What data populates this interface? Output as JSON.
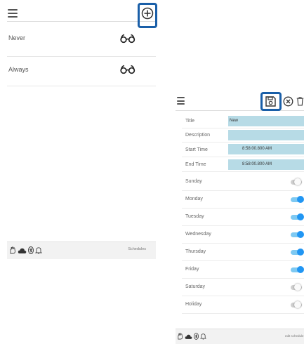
{
  "left_screen": {
    "add_icon": "plus-circle-icon",
    "schedules": [
      {
        "label": "Never",
        "icon": "glasses-icon"
      },
      {
        "label": "Always",
        "icon": "glasses-icon"
      }
    ],
    "status_icons": [
      "hand-icon",
      "cloud-icon",
      "bluetooth-icon",
      "bell-icon"
    ],
    "status_label": "Schedules"
  },
  "right_screen": {
    "toolbar_icons": [
      "save-icon",
      "close-circle-icon",
      "trash-icon"
    ],
    "fields": {
      "title_label": "Title",
      "title_value": "New",
      "description_label": "Description",
      "description_value": "",
      "start_label": "Start Time",
      "start_value": "8:58:00.800 AM",
      "end_label": "End Time",
      "end_value": "8:58:00.800 AM"
    },
    "days": [
      {
        "label": "Sunday",
        "on": false
      },
      {
        "label": "Monday",
        "on": true
      },
      {
        "label": "Tuesday",
        "on": true
      },
      {
        "label": "Wednesday",
        "on": true
      },
      {
        "label": "Thursday",
        "on": true
      },
      {
        "label": "Friday",
        "on": true
      },
      {
        "label": "Saturday",
        "on": false
      },
      {
        "label": "Holiday",
        "on": false
      }
    ],
    "status_icons": [
      "hand-icon",
      "cloud-icon",
      "bluetooth-icon",
      "bell-icon"
    ],
    "status_label": "edit schedule"
  },
  "colors": {
    "highlight": "#1a5fa8",
    "field_bg": "#b7dbe6",
    "toggle_on": "#2196f3"
  }
}
